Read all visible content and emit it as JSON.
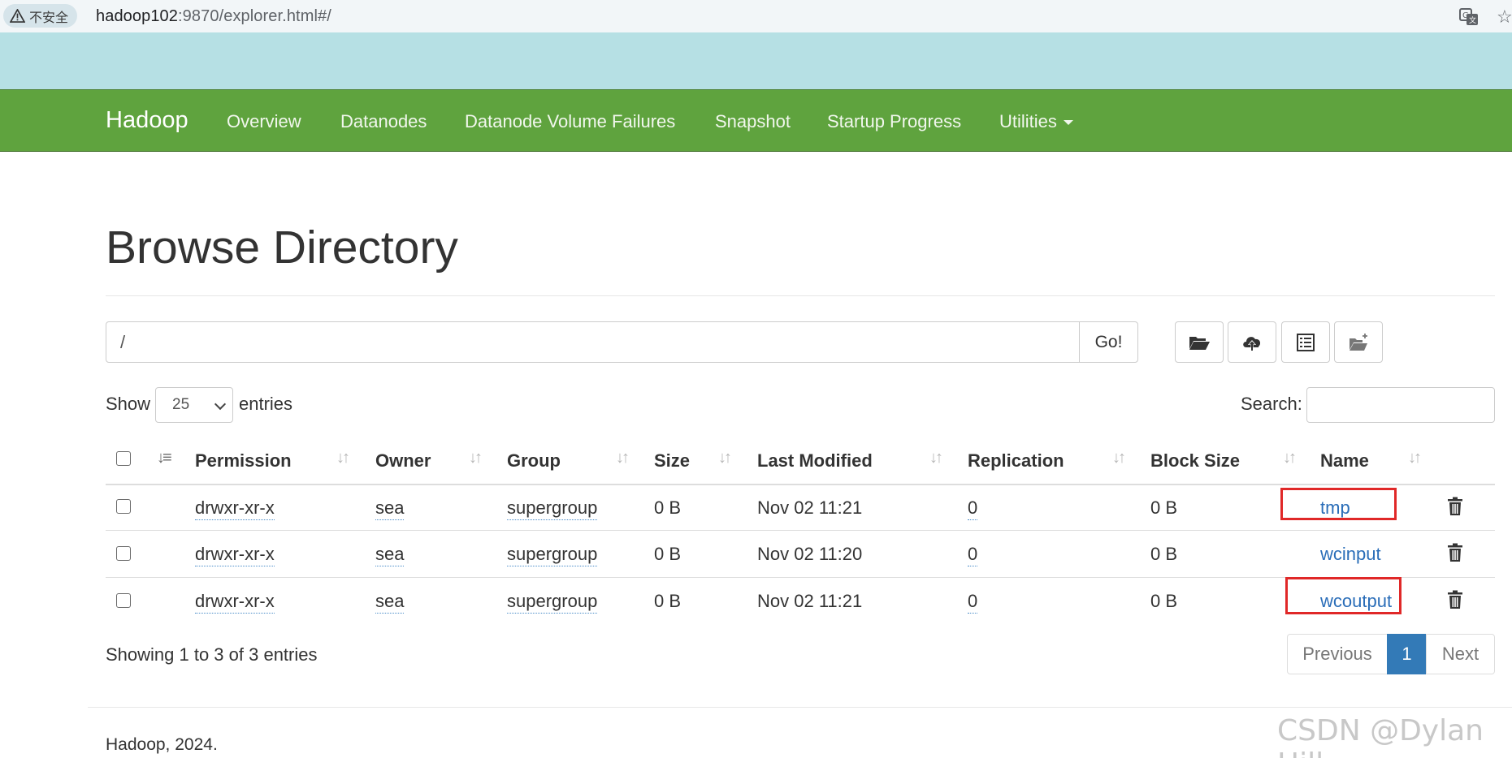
{
  "browser": {
    "security_chip": "不安全",
    "url_host": "hadoop102",
    "url_rest": ":9870/explorer.html#/"
  },
  "navbar": {
    "brand": "Hadoop",
    "items": [
      "Overview",
      "Datanodes",
      "Datanode Volume Failures",
      "Snapshot",
      "Startup Progress",
      "Utilities"
    ]
  },
  "page": {
    "title": "Browse Directory",
    "path_value": "/",
    "go_label": "Go!",
    "tools": [
      "folder-open-icon",
      "cloud-upload-icon",
      "list-icon",
      "new-folder-icon"
    ]
  },
  "controls": {
    "show_label": "Show",
    "entries_value": "25",
    "entries_label": "entries",
    "search_label": "Search:"
  },
  "table": {
    "columns": [
      "Permission",
      "Owner",
      "Group",
      "Size",
      "Last Modified",
      "Replication",
      "Block Size",
      "Name"
    ],
    "rows": [
      {
        "permission": "drwxr-xr-x",
        "owner": "sea",
        "group": "supergroup",
        "size": "0 B",
        "modified": "Nov 02 11:21",
        "replication": "0",
        "block_size": "0 B",
        "name": "tmp",
        "highlighted": true
      },
      {
        "permission": "drwxr-xr-x",
        "owner": "sea",
        "group": "supergroup",
        "size": "0 B",
        "modified": "Nov 02 11:20",
        "replication": "0",
        "block_size": "0 B",
        "name": "wcinput",
        "highlighted": false
      },
      {
        "permission": "drwxr-xr-x",
        "owner": "sea",
        "group": "supergroup",
        "size": "0 B",
        "modified": "Nov 02 11:21",
        "replication": "0",
        "block_size": "0 B",
        "name": "wcoutput",
        "highlighted": true
      }
    ]
  },
  "pagination": {
    "info": "Showing 1 to 3 of 3 entries",
    "previous": "Previous",
    "current": "1",
    "next": "Next"
  },
  "footer": {
    "text": "Hadoop, 2024.",
    "watermark": "CSDN @Dylan Hill"
  },
  "colors": {
    "navbar": "#5fa33e",
    "link": "#2a6db8",
    "active_page": "#337ab7",
    "highlight_box": "#e02828",
    "band": "#b6e0e4"
  }
}
